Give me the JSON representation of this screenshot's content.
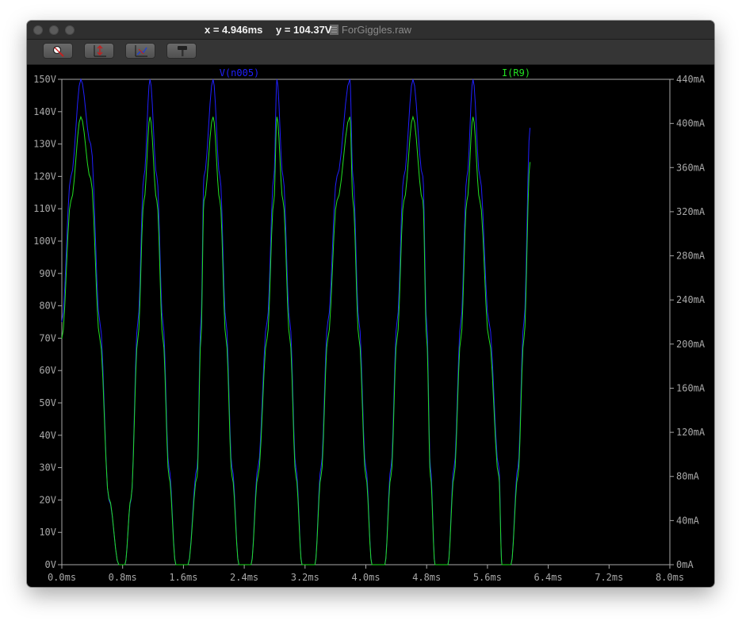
{
  "window": {
    "title": "ForGiggles.raw"
  },
  "toolbar": {
    "buttons": [
      {
        "icon": "zoom-icon"
      },
      {
        "icon": "autorange-icon"
      },
      {
        "icon": "cursor-icon"
      },
      {
        "icon": "hammer-icon"
      }
    ],
    "cursor_x": "x = 4.946ms",
    "cursor_y": "y = 104.37V"
  },
  "colors": {
    "background": "#000000",
    "axis": "#a8a8a8",
    "series_v": "#2020ff",
    "series_i": "#22e022"
  },
  "chart_data": {
    "type": "line",
    "x_unit": "ms",
    "xlim": [
      0.0,
      8.0
    ],
    "x_ticks": [
      "0.0ms",
      "0.8ms",
      "1.6ms",
      "2.4ms",
      "3.2ms",
      "4.0ms",
      "4.8ms",
      "5.6ms",
      "6.4ms",
      "7.2ms",
      "8.0ms"
    ],
    "y_left_lim": [
      0,
      150
    ],
    "y_left_ticks": [
      "0V",
      "10V",
      "20V",
      "30V",
      "40V",
      "50V",
      "60V",
      "70V",
      "80V",
      "90V",
      "100V",
      "110V",
      "120V",
      "130V",
      "140V",
      "150V"
    ],
    "y_right_lim": [
      0,
      440
    ],
    "y_right_ticks": [
      "0mA",
      "40mA",
      "80mA",
      "120mA",
      "160mA",
      "200mA",
      "240mA",
      "280mA",
      "320mA",
      "360mA",
      "400mA",
      "440mA"
    ],
    "series": [
      {
        "name": "V(n005)",
        "axis": "left",
        "x": [
          0.0,
          0.12,
          0.25,
          0.38,
          0.5,
          0.62,
          0.75,
          0.8,
          0.83,
          0.91,
          1.0,
          1.08,
          1.16,
          1.25,
          1.33,
          1.41,
          1.5,
          1.58,
          1.66,
          1.78,
          1.83,
          1.87,
          1.99,
          2.08,
          2.16,
          2.24,
          2.33,
          2.41,
          2.49,
          2.58,
          2.7,
          2.79,
          2.83,
          2.91,
          3.0,
          3.08,
          3.16,
          3.25,
          3.33,
          3.41,
          3.5,
          3.62,
          3.79,
          3.83,
          3.91,
          4.0,
          4.08,
          4.16,
          4.25,
          4.33,
          4.41,
          4.5,
          4.62,
          4.75,
          4.8,
          4.85,
          4.91,
          5.0,
          5.08,
          5.16,
          5.25,
          5.33,
          5.41,
          5.5,
          5.62,
          5.75,
          5.79,
          5.83,
          5.91,
          6.0,
          6.08,
          6.16
        ],
        "y": [
          75,
          120,
          150,
          130,
          75,
          20,
          0,
          0,
          0,
          20,
          75,
          120,
          150,
          120,
          75,
          30,
          0,
          0,
          0,
          30,
          75,
          120,
          150,
          120,
          75,
          30,
          0,
          0,
          0,
          30,
          75,
          120,
          150,
          120,
          75,
          30,
          0,
          0,
          0,
          30,
          75,
          120,
          150,
          120,
          75,
          30,
          0,
          0,
          0,
          30,
          75,
          120,
          150,
          120,
          75,
          30,
          0,
          0,
          0,
          30,
          75,
          120,
          150,
          120,
          75,
          30,
          0,
          0,
          0,
          30,
          75,
          135
        ]
      },
      {
        "name": "I(R9)",
        "axis": "right",
        "x": [
          0.0,
          0.12,
          0.25,
          0.38,
          0.5,
          0.62,
          0.75,
          0.8,
          0.83,
          0.91,
          1.0,
          1.08,
          1.16,
          1.25,
          1.33,
          1.41,
          1.5,
          1.58,
          1.66,
          1.78,
          1.83,
          1.87,
          1.99,
          2.08,
          2.16,
          2.24,
          2.33,
          2.41,
          2.49,
          2.58,
          2.7,
          2.79,
          2.83,
          2.91,
          3.0,
          3.08,
          3.16,
          3.25,
          3.33,
          3.41,
          3.5,
          3.62,
          3.79,
          3.83,
          3.91,
          4.0,
          4.08,
          4.16,
          4.25,
          4.33,
          4.41,
          4.5,
          4.62,
          4.75,
          4.8,
          4.85,
          4.91,
          5.0,
          5.08,
          5.16,
          5.25,
          5.33,
          5.41,
          5.5,
          5.62,
          5.75,
          5.79,
          5.83,
          5.91,
          6.0,
          6.08,
          6.16
        ],
        "y": [
          205,
          330,
          406,
          350,
          205,
          60,
          0,
          0,
          0,
          60,
          205,
          330,
          406,
          330,
          205,
          80,
          0,
          0,
          0,
          80,
          205,
          330,
          406,
          330,
          205,
          80,
          0,
          0,
          0,
          80,
          205,
          330,
          406,
          330,
          205,
          80,
          0,
          0,
          0,
          80,
          205,
          330,
          406,
          330,
          205,
          80,
          0,
          0,
          0,
          80,
          205,
          330,
          406,
          330,
          205,
          80,
          0,
          0,
          0,
          80,
          205,
          330,
          406,
          330,
          205,
          80,
          0,
          0,
          0,
          80,
          205,
          365
        ]
      }
    ]
  }
}
